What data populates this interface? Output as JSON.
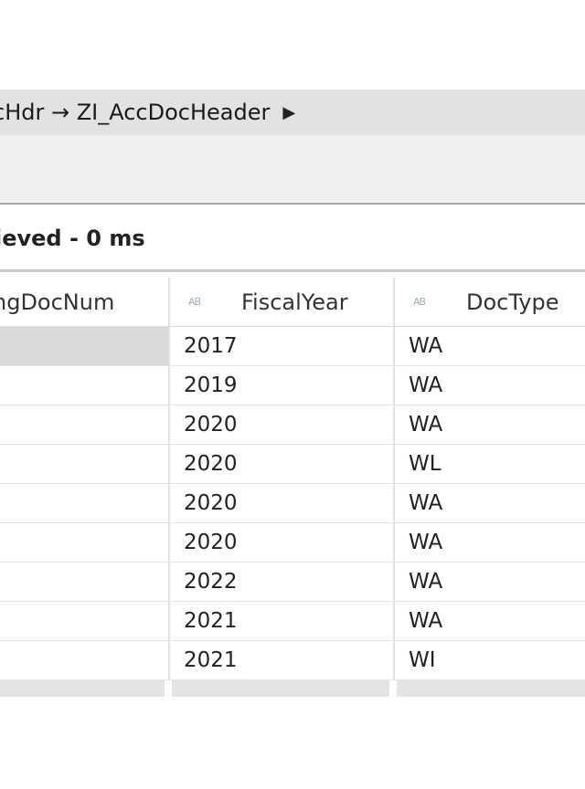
{
  "breadcrumb": {
    "text": "cHdr → ZI_AccDocHeader",
    "chevron": "chevron-right-icon"
  },
  "status": {
    "text": "ieved - 0 ms"
  },
  "grid": {
    "columns": [
      {
        "label": "ngDocNum",
        "type_icon": ""
      },
      {
        "label": "FiscalYear",
        "type_icon": "AB"
      },
      {
        "label": "DocType",
        "type_icon": "AB"
      }
    ],
    "rows": [
      {
        "col1": "",
        "fiscal_year": "2017",
        "doc_type": "WA"
      },
      {
        "col1": "",
        "fiscal_year": "2019",
        "doc_type": "WA"
      },
      {
        "col1": "",
        "fiscal_year": "2020",
        "doc_type": "WA"
      },
      {
        "col1": "",
        "fiscal_year": "2020",
        "doc_type": "WL"
      },
      {
        "col1": "",
        "fiscal_year": "2020",
        "doc_type": "WA"
      },
      {
        "col1": "",
        "fiscal_year": "2020",
        "doc_type": "WA"
      },
      {
        "col1": "",
        "fiscal_year": "2022",
        "doc_type": "WA"
      },
      {
        "col1": "",
        "fiscal_year": "2021",
        "doc_type": "WA"
      },
      {
        "col1": "",
        "fiscal_year": "2021",
        "doc_type": "WI"
      }
    ]
  }
}
